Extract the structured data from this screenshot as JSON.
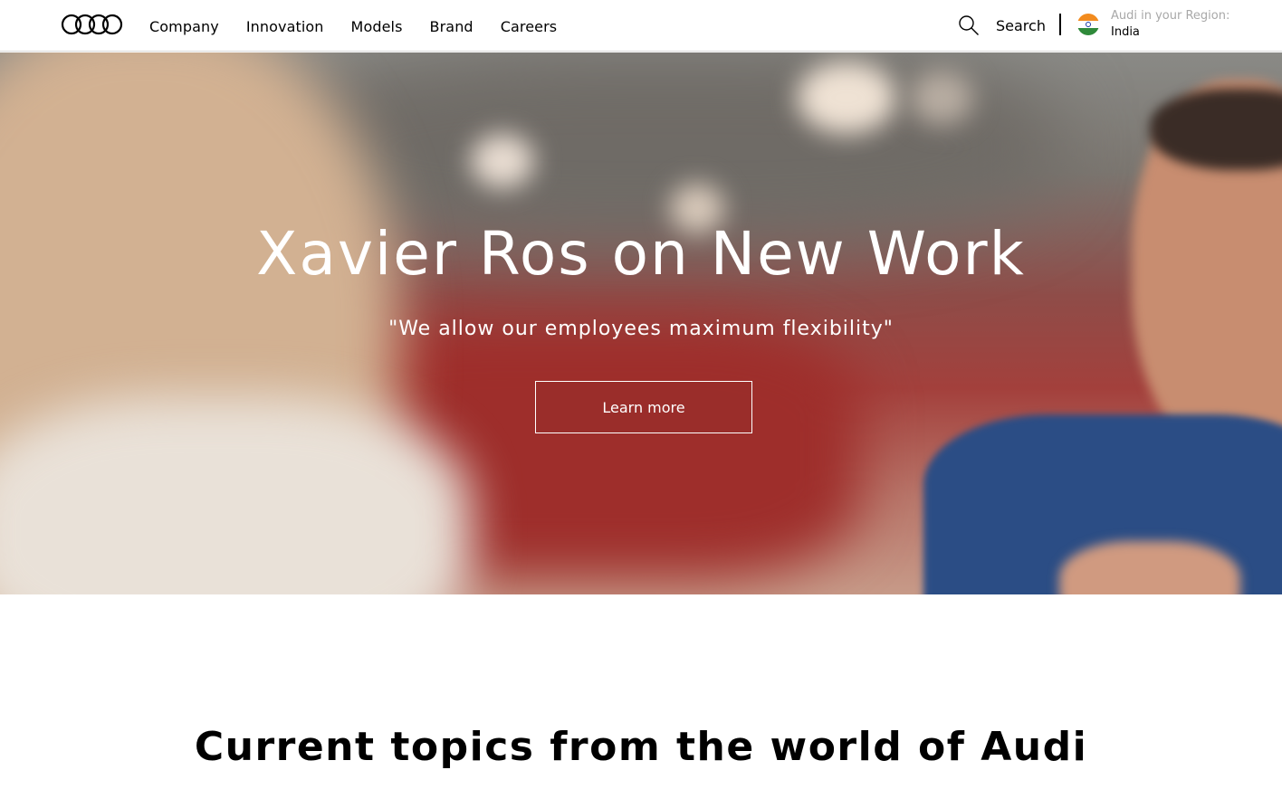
{
  "header": {
    "nav": [
      {
        "label": "Company"
      },
      {
        "label": "Innovation"
      },
      {
        "label": "Models"
      },
      {
        "label": "Brand"
      },
      {
        "label": "Careers"
      }
    ],
    "search_label": "Search",
    "region_label": "Audi in your Region:",
    "region_value": "India"
  },
  "hero": {
    "title": "Xavier Ros on New Work",
    "subtitle": "\"We allow our employees maximum flexibility\"",
    "cta_label": "Learn more"
  },
  "section": {
    "title": "Current topics from the world of Audi"
  },
  "icons": {
    "logo": "audi-rings-icon",
    "search": "search-icon",
    "flag": "india-flag-icon"
  },
  "colors": {
    "flag_saffron": "#f28b1e",
    "flag_white": "#ffffff",
    "flag_green": "#2f8a3a",
    "region_label": "#a8a8a8"
  }
}
